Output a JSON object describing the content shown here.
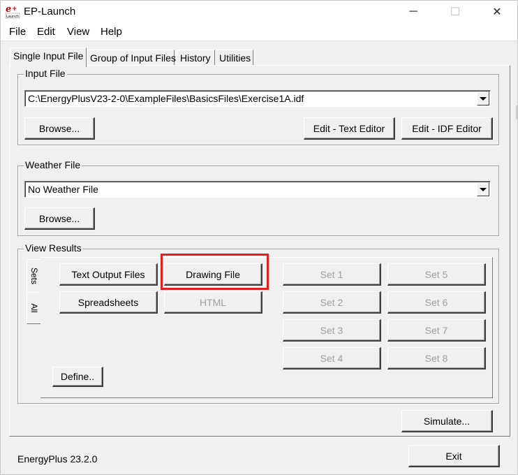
{
  "window": {
    "title": "EP-Launch",
    "icon": "ep-launch-icon",
    "controls": {
      "minimize": "─",
      "maximize": "☐",
      "close": "✕"
    }
  },
  "menu": [
    "File",
    "Edit",
    "View",
    "Help"
  ],
  "tabs": [
    "Single Input File",
    "Group of Input Files",
    "History",
    "Utilities"
  ],
  "input_file": {
    "label": "Input File",
    "value": "C:\\EnergyPlusV23-2-0\\ExampleFiles\\BasicsFiles\\Exercise1A.idf",
    "browse": "Browse...",
    "edit_text": "Edit - Text Editor",
    "edit_idf": "Edit - IDF Editor"
  },
  "weather_file": {
    "label": "Weather File",
    "value": "No Weather File",
    "browse": "Browse..."
  },
  "view_results": {
    "label": "View Results",
    "side_tabs": [
      "Sets",
      "All"
    ],
    "text_output": "Text Output Files",
    "drawing": "Drawing File",
    "spreadsheets": "Spreadsheets",
    "html": "HTML",
    "sets": [
      "Set 1",
      "Set 2",
      "Set 3",
      "Set 4",
      "Set 5",
      "Set 6",
      "Set 7",
      "Set 8"
    ],
    "define": "Define.."
  },
  "simulate": "Simulate...",
  "version": "EnergyPlus 23.2.0",
  "exit": "Exit",
  "colors": {
    "highlight": "#e02020",
    "disabled_text": "#a0a0a0",
    "face": "#f0f0f0"
  }
}
